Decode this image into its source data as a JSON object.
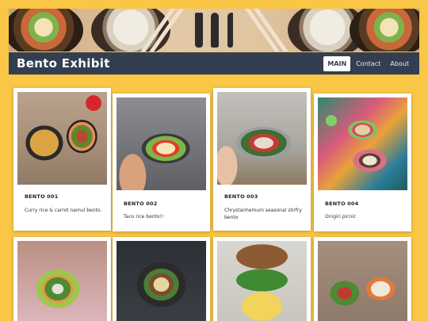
{
  "banner": {
    "icon": "cutlery-icon"
  },
  "header": {
    "brand": "Bento Exhibit",
    "nav": [
      {
        "label": "MAIN",
        "active": true
      },
      {
        "label": "Contact",
        "active": false
      },
      {
        "label": "About",
        "active": false
      }
    ]
  },
  "colors": {
    "background": "#f9c645",
    "navbar": "#343e52",
    "card": "#ffffff"
  },
  "cards": [
    {
      "title": "BENTO 001",
      "description": "Curry rice & carrot namul bento."
    },
    {
      "title": "BENTO 002",
      "description": "Taco rice bento!!"
    },
    {
      "title": "BENTO 003",
      "description": "Chrystanhemum seasonal stirfry bento"
    },
    {
      "title": "BENTO 004",
      "description": "Onigiri picnic"
    },
    {
      "title": "",
      "description": ""
    },
    {
      "title": "",
      "description": ""
    },
    {
      "title": "",
      "description": ""
    },
    {
      "title": "",
      "description": ""
    }
  ]
}
